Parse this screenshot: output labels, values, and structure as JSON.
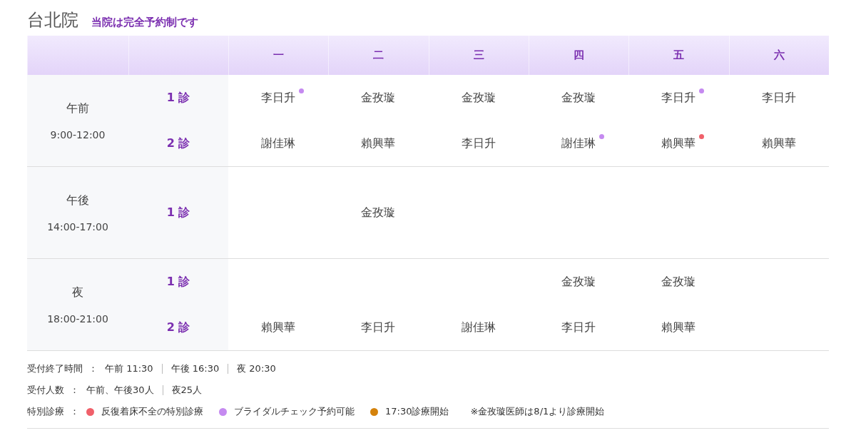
{
  "header": {
    "title": "台北院",
    "subtitle": "当院は完全予約制です"
  },
  "table": {
    "days": [
      "一",
      "二",
      "三",
      "四",
      "五",
      "六"
    ],
    "sessions": [
      {
        "name": "午前",
        "hours": "9:00-12:00",
        "rooms": [
          {
            "label": "1 診",
            "cells": [
              {
                "doctor": "李日升",
                "color": "#c58af0"
              },
              {
                "doctor": "金孜璇"
              },
              {
                "doctor": "金孜璇"
              },
              {
                "doctor": "金孜璇"
              },
              {
                "doctor": "李日升",
                "color": "#c58af0"
              },
              {
                "doctor": "李日升"
              }
            ]
          },
          {
            "label": "2 診",
            "cells": [
              {
                "doctor": "謝佳琳"
              },
              {
                "doctor": "賴興華"
              },
              {
                "doctor": "李日升"
              },
              {
                "doctor": "謝佳琳",
                "color": "#c58af0"
              },
              {
                "doctor": "賴興華",
                "color": "#f0606a"
              },
              {
                "doctor": "賴興華"
              }
            ]
          }
        ]
      },
      {
        "name": "午後",
        "hours": "14:00-17:00",
        "rooms": [
          {
            "label": "1 診",
            "cells": [
              null,
              {
                "doctor": "金孜璇"
              },
              null,
              null,
              null,
              null
            ]
          }
        ]
      },
      {
        "name": "夜",
        "hours": "18:00-21:00",
        "rooms": [
          {
            "label": "1 診",
            "cells": [
              null,
              null,
              null,
              {
                "doctor": "金孜璇"
              },
              {
                "doctor": "金孜璇"
              },
              null
            ]
          },
          {
            "label": "2 診",
            "cells": [
              {
                "doctor": "賴興華"
              },
              {
                "doctor": "李日升"
              },
              {
                "doctor": "謝佳琳"
              },
              {
                "doctor": "李日升"
              },
              {
                "doctor": "賴興華"
              },
              null
            ]
          }
        ]
      }
    ]
  },
  "notes": [
    {
      "kind": "list",
      "label": "受付終了時間",
      "colon": "：",
      "items": [
        "午前 11:30",
        "午後 16:30",
        "夜 20:30"
      ]
    },
    {
      "kind": "list",
      "label": "受付人数",
      "colon": "：",
      "items": [
        "午前、午後30人",
        "夜25人"
      ]
    },
    {
      "kind": "legend",
      "label": "特別診療",
      "colon": "：",
      "items": [
        {
          "text": "反復着床不全の特別診療",
          "color": "#f0606a"
        },
        {
          "text": "ブライダルチェック予約可能",
          "color": "#c58af0"
        },
        {
          "text": "17:30診療開始",
          "color": "#d4820c"
        }
      ],
      "note": "※金孜璇医師は8/1より診療開始"
    }
  ]
}
